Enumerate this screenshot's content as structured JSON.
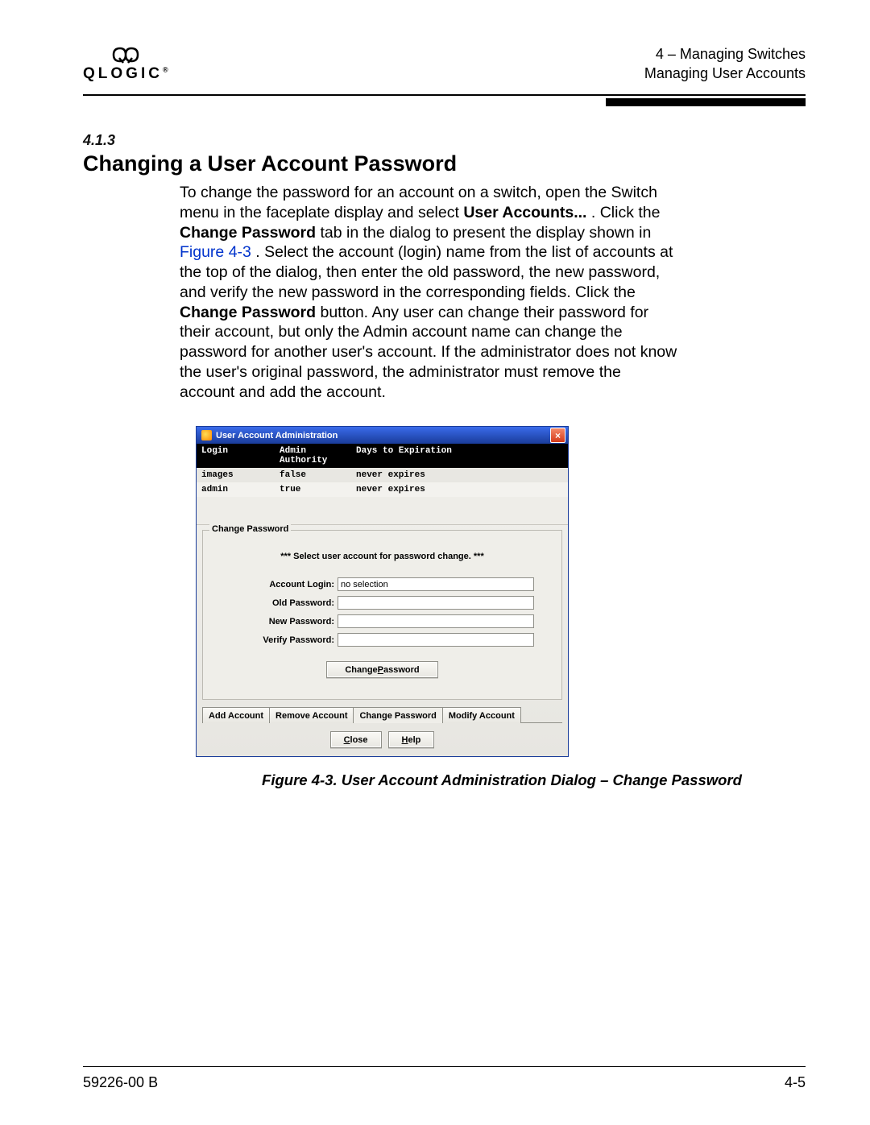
{
  "header": {
    "logo_text": "QLOGIC",
    "section_path_line1": "4 – Managing Switches",
    "section_path_line2": "Managing User Accounts"
  },
  "section": {
    "number": "4.1.3",
    "title": "Changing a User Account Password"
  },
  "para": {
    "t1": "To change the password for an account on a switch, open the Switch menu in the faceplate display and select ",
    "b1": "User Accounts...",
    "t2": ". Click the ",
    "b2": "Change Password",
    "t3": " tab in the dialog to present the display shown in ",
    "link": "Figure 4-3",
    "t4": ". Select the account (login) name from the list of accounts at the top of the dialog, then enter the old password, the new password, and verify the new password in the corresponding fields. Click the ",
    "b3": "Change Password",
    "t5": " button. Any user can change their password for their account, but only the Admin account name can change the password for another user's account. If the administrator does not know the user's original password, the administrator must remove the account and add the account."
  },
  "dialog": {
    "title": "User Account Administration",
    "close_x": "×",
    "columns": {
      "login": "Login",
      "admin": "Admin Authority",
      "exp": "Days to Expiration"
    },
    "rows": [
      {
        "login": "images",
        "admin": "false",
        "exp": "never expires"
      },
      {
        "login": "admin",
        "admin": "true",
        "exp": "never expires"
      }
    ],
    "cp": {
      "legend": "Change Password",
      "note": "*** Select user account for password change. ***",
      "labels": {
        "account_login": "Account Login:",
        "old_pw": "Old Password:",
        "new_pw": "New Password:",
        "verify_pw": "Verify Password:"
      },
      "account_login_value": "no selection",
      "button_pre": "Change ",
      "button_mn": "P",
      "button_post": "assword"
    },
    "tabs": {
      "add": "Add Account",
      "remove": "Remove Account",
      "change": "Change Password",
      "modify": "Modify Account"
    },
    "bottom": {
      "close_pre": "",
      "close_mn": "C",
      "close_post": "lose",
      "help_pre": "",
      "help_mn": "H",
      "help_post": "elp"
    }
  },
  "figure_caption": "Figure 4-3.  User Account Administration Dialog – Change Password",
  "footer": {
    "left": "59226-00 B",
    "right": "4-5"
  }
}
